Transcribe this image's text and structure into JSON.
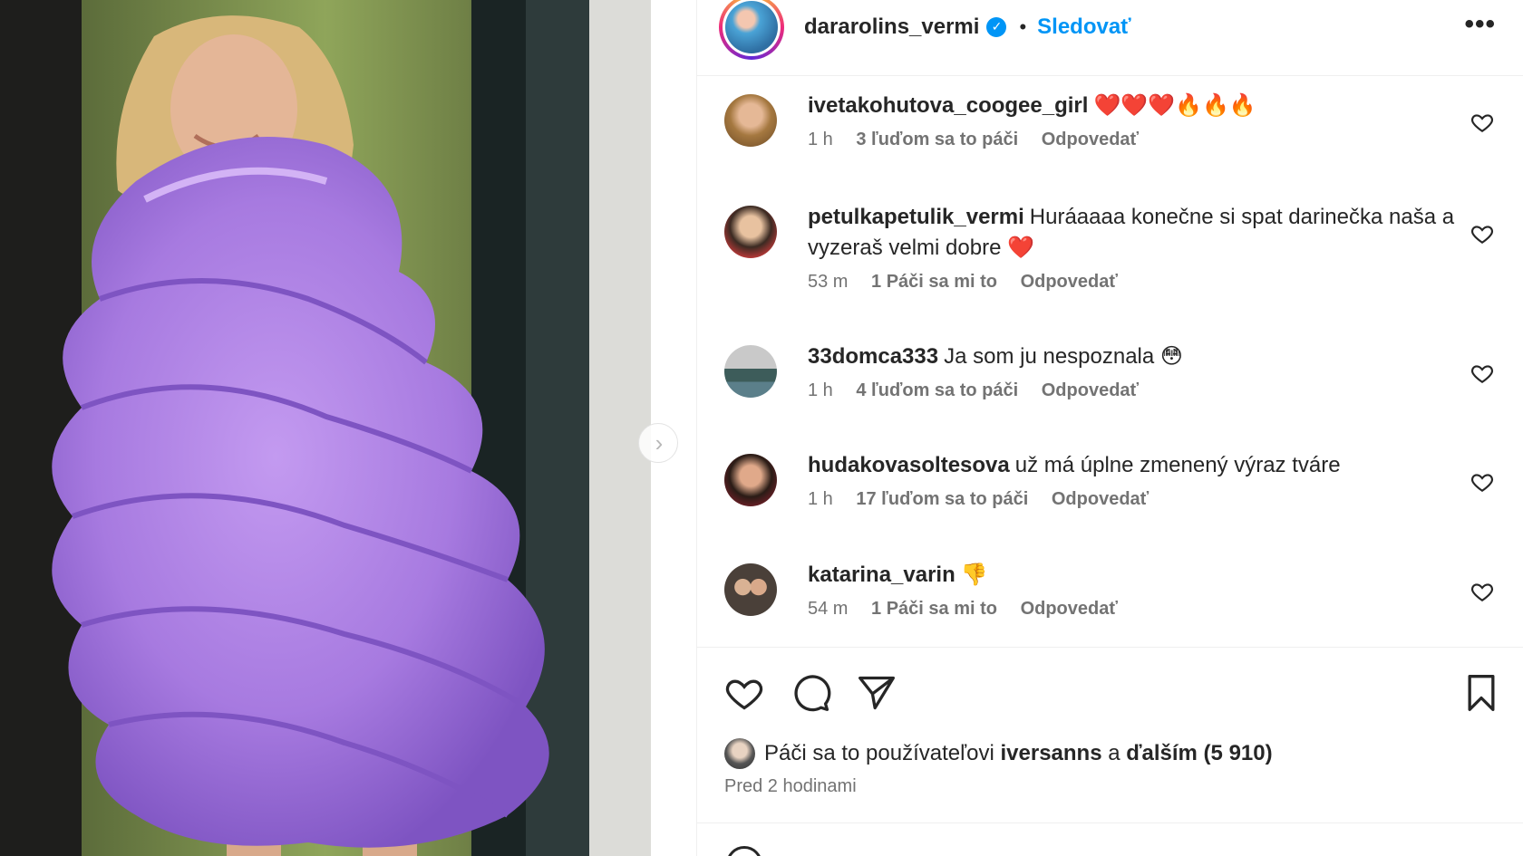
{
  "post": {
    "author": "dararolins_vermi",
    "separator": "•",
    "follow_label": "Sledovať",
    "more_label": "•••",
    "next_label": "›"
  },
  "comments": [
    {
      "user": "ivetakohutova_coogee_girl",
      "text": "❤️❤️❤️🔥🔥🔥",
      "time": "1 h",
      "likes": "3 ľuďom sa to páči",
      "reply": "Odpovedať"
    },
    {
      "user": "petulkapetulik_vermi",
      "text": "Huráaaaa konečne si spat darinečka naša a vyzeraš velmi dobre ❤️",
      "time": "53 m",
      "likes": "1 Páči sa mi to",
      "reply": "Odpovedať"
    },
    {
      "user": "33domca333",
      "text": "Ja som ju nespoznala 😳",
      "time": "1 h",
      "likes": "4 ľuďom sa to páči",
      "reply": "Odpovedať"
    },
    {
      "user": "hudakovasoltesova",
      "text": "už má úplne zmenený výraz tváre",
      "time": "1 h",
      "likes": "17 ľuďom sa to páči",
      "reply": "Odpovedať"
    },
    {
      "user": "katarina_varin",
      "text": "👎",
      "time": "54 m",
      "likes": "1 Páči sa mi to",
      "reply": "Odpovedať"
    }
  ],
  "footer": {
    "likes_prefix": "Páči sa to používateľovi",
    "likes_user": "iversanns",
    "likes_and": "a",
    "likes_others": "ďalším (5 910)",
    "time": "Pred 2 hodinami"
  },
  "colors": {
    "accent": "#0095f6",
    "dress": "#a97be0",
    "text": "#262626",
    "muted": "#737373"
  }
}
